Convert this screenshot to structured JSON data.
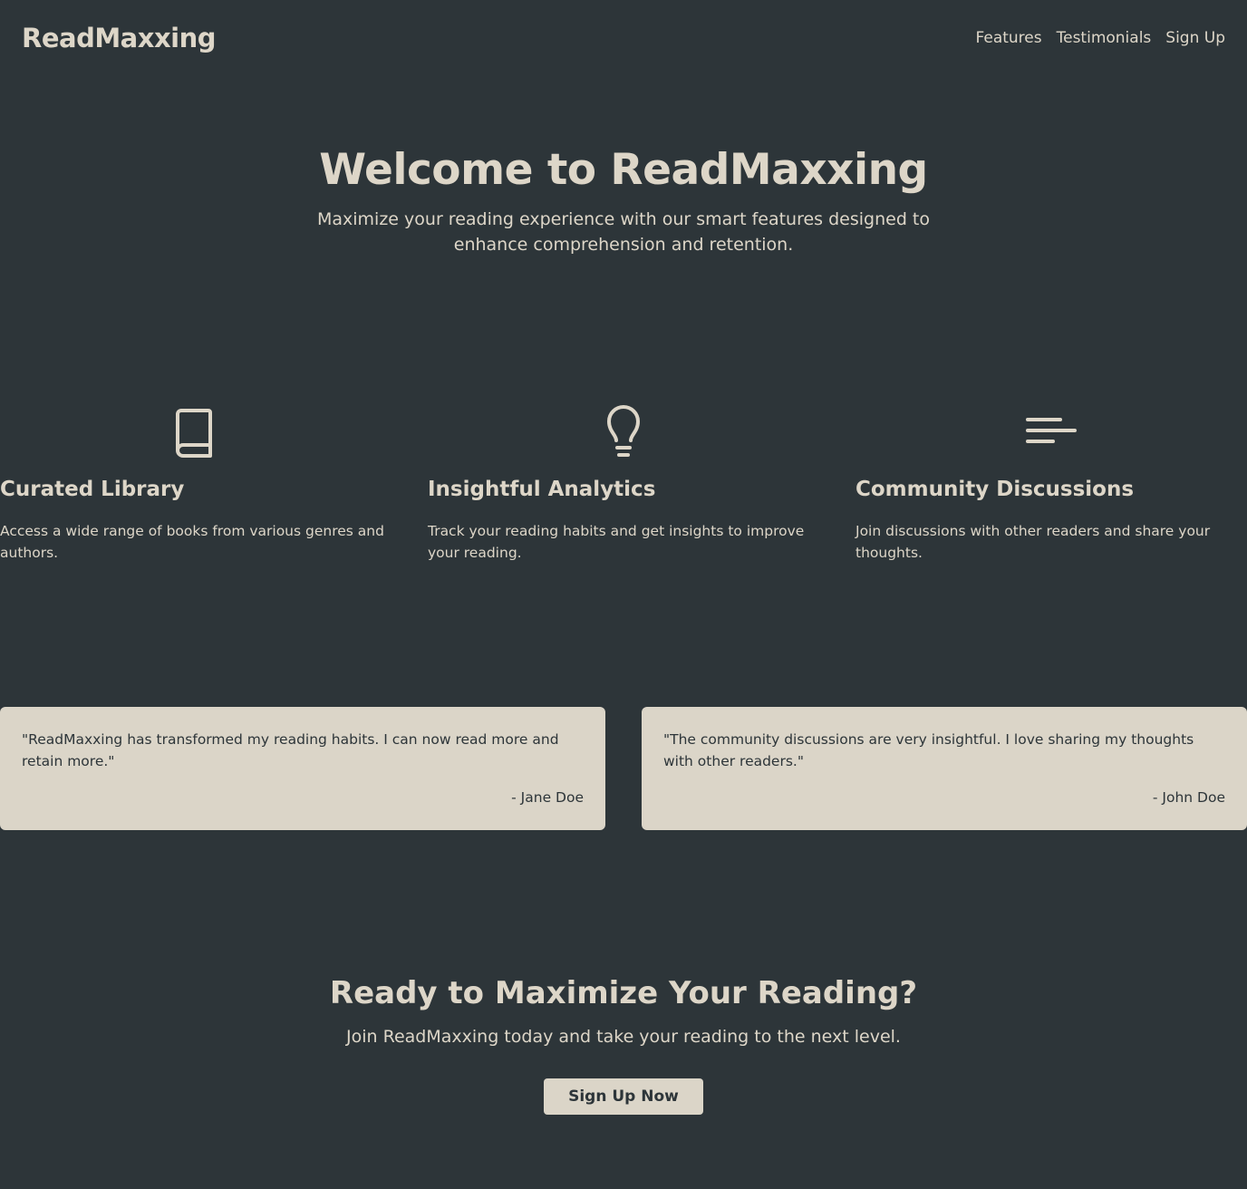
{
  "header": {
    "logo": "ReadMaxxing",
    "nav": [
      "Features",
      "Testimonials",
      "Sign Up"
    ]
  },
  "hero": {
    "title": "Welcome to ReadMaxxing",
    "subtitle": "Maximize your reading experience with our smart features designed to enhance comprehension and retention."
  },
  "features": [
    {
      "icon": "book-icon",
      "title": "Curated Library",
      "description": "Access a wide range of books from various genres and authors."
    },
    {
      "icon": "lightbulb-icon",
      "title": "Insightful Analytics",
      "description": "Track your reading habits and get insights to improve your reading."
    },
    {
      "icon": "menu-lines-icon",
      "title": "Community Discussions",
      "description": "Join discussions with other readers and share your thoughts."
    }
  ],
  "testimonials": [
    {
      "quote": "\"ReadMaxxing has transformed my reading habits. I can now read more and retain more.\"",
      "author": "- Jane Doe"
    },
    {
      "quote": "\"The community discussions are very insightful. I love sharing my thoughts with other readers.\"",
      "author": "- John Doe"
    }
  ],
  "cta": {
    "title": "Ready to Maximize Your Reading?",
    "subtitle": "Join ReadMaxxing today and take your reading to the next level.",
    "button": "Sign Up Now"
  },
  "colors": {
    "background": "#2d3539",
    "text": "#ddd6c8",
    "card": "#dbd5c8"
  }
}
